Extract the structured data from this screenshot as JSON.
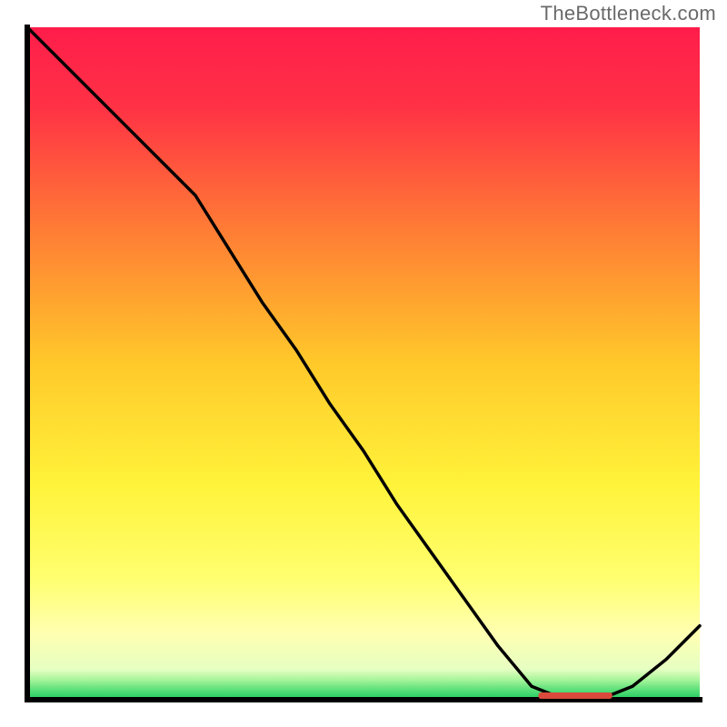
{
  "watermark": "TheBottleneck.com",
  "chart_data": {
    "type": "line",
    "x": [
      0.0,
      0.1,
      0.2,
      0.25,
      0.3,
      0.35,
      0.4,
      0.45,
      0.5,
      0.55,
      0.6,
      0.65,
      0.7,
      0.75,
      0.8,
      0.85,
      0.9,
      0.95,
      1.0
    ],
    "values": [
      1.0,
      0.9,
      0.8,
      0.75,
      0.67,
      0.59,
      0.52,
      0.44,
      0.37,
      0.29,
      0.22,
      0.15,
      0.08,
      0.02,
      0.0,
      0.0,
      0.02,
      0.06,
      0.11
    ],
    "title": "",
    "xlabel": "",
    "ylabel": "",
    "xlim": [
      0,
      1
    ],
    "ylim": [
      0,
      1
    ],
    "plateau_start_x": 0.76,
    "plateau_end_x": 0.87,
    "plateau_y": 0.0,
    "gradient_stops": [
      {
        "offset": 0.0,
        "color": "#ff1d4b"
      },
      {
        "offset": 0.12,
        "color": "#ff3245"
      },
      {
        "offset": 0.3,
        "color": "#ff7c35"
      },
      {
        "offset": 0.5,
        "color": "#ffc92a"
      },
      {
        "offset": 0.68,
        "color": "#fff33a"
      },
      {
        "offset": 0.82,
        "color": "#ffff70"
      },
      {
        "offset": 0.9,
        "color": "#ffffb0"
      },
      {
        "offset": 0.955,
        "color": "#e6ffc2"
      },
      {
        "offset": 0.97,
        "color": "#a8f59b"
      },
      {
        "offset": 0.985,
        "color": "#5ce07a"
      },
      {
        "offset": 1.0,
        "color": "#1dc95d"
      }
    ],
    "axis_color": "#000000",
    "line_color": "#000000",
    "plateau_marker_color": "#d94a3c"
  }
}
